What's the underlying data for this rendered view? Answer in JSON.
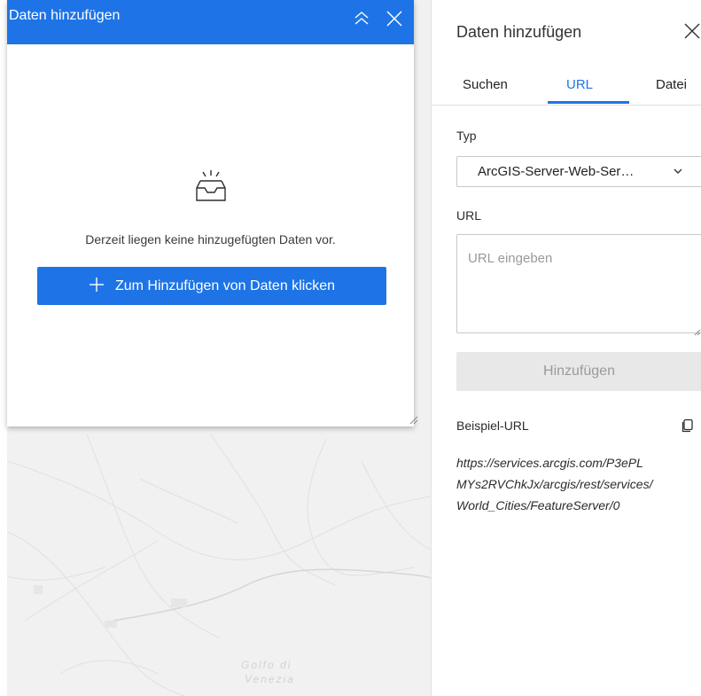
{
  "map": {
    "labels": [
      "Golfo di",
      "Venezia"
    ]
  },
  "widget": {
    "title": "Daten hinzufügen",
    "collapse_icon": "double-chevron-up-icon",
    "close_icon": "close-icon",
    "empty_icon": "empty-inbox-icon",
    "empty_text": "Derzeit liegen keine hinzugefügten Daten vor.",
    "add_button": {
      "icon": "plus-icon",
      "label": "Zum Hinzufügen von Daten klicken"
    },
    "header_color": "#1e74e6"
  },
  "panel": {
    "title": "Daten hinzufügen",
    "close_icon": "close-icon",
    "tabs": [
      {
        "label": "Suchen",
        "active": false
      },
      {
        "label": "URL",
        "active": true
      },
      {
        "label": "Datei",
        "active": false
      }
    ],
    "type_label": "Typ",
    "type_select": {
      "value": "ArcGIS-Server-Web-Ser…",
      "icon": "chevron-down-icon"
    },
    "url_label": "URL",
    "url_input": {
      "value": "",
      "placeholder": "URL eingeben"
    },
    "add_button_label": "Hinzufügen",
    "example_label": "Beispiel-URL",
    "copy_icon": "copy-icon",
    "example_url_lines": [
      "https://services.arcgis.com/P3ePL",
      "MYs2RVChkJx/arcgis/rest/services/",
      "World_Cities/FeatureServer/0"
    ],
    "accent_color": "#1e74e6"
  }
}
